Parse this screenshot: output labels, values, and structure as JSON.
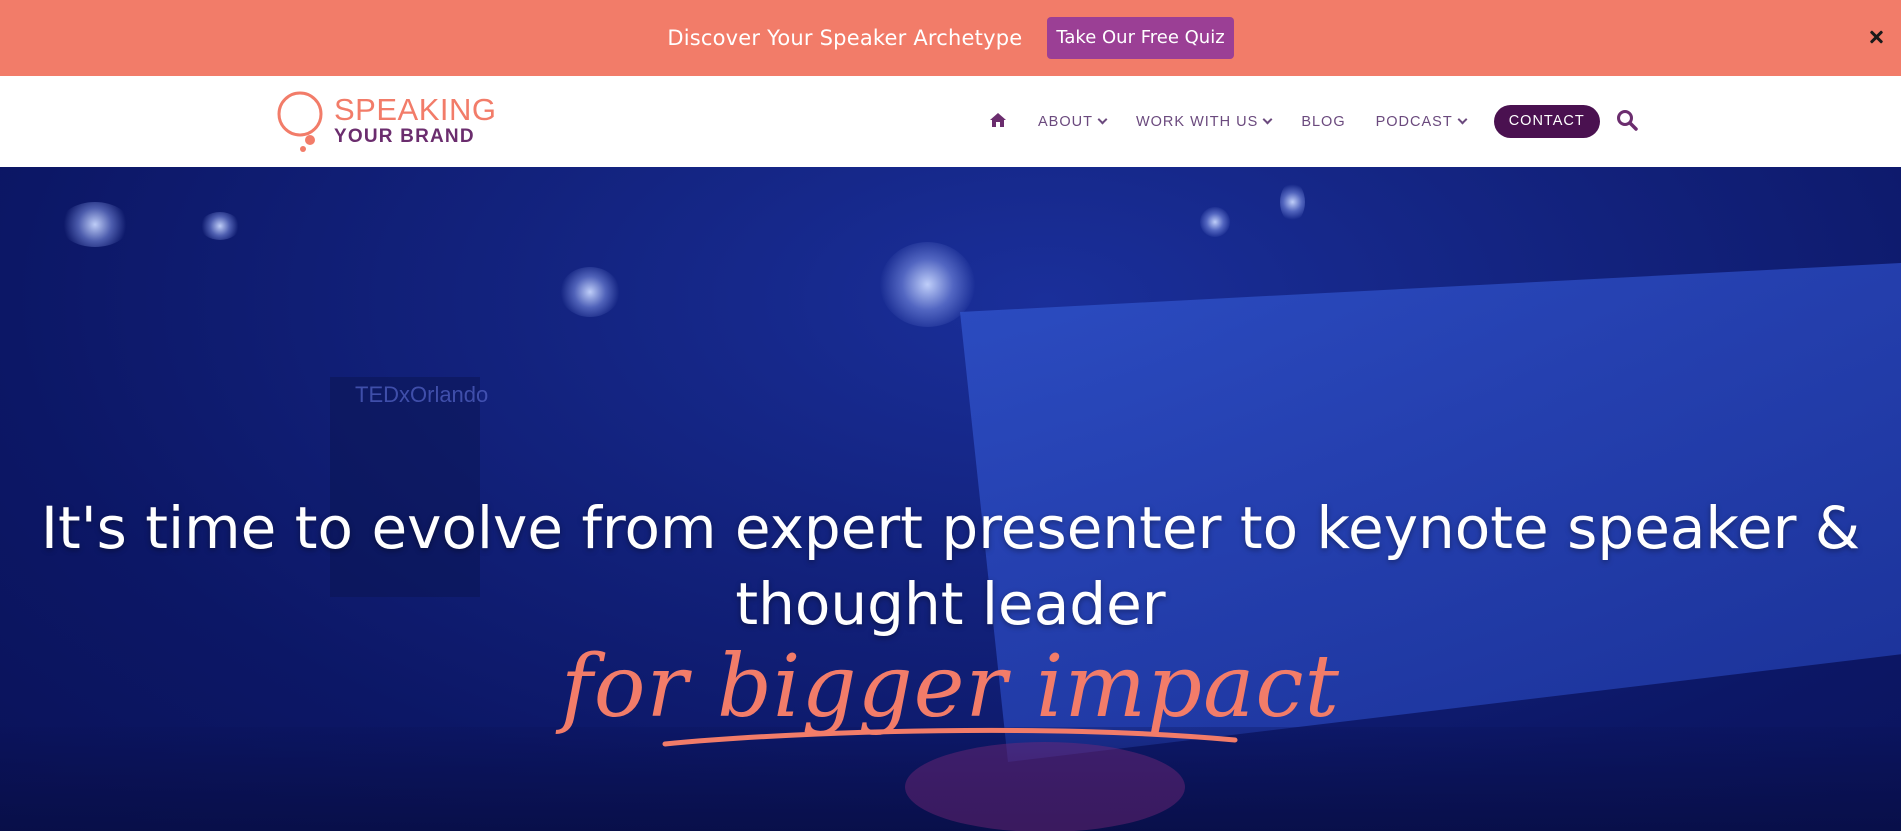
{
  "announcement": {
    "text": "Discover Your Speaker Archetype",
    "cta_label": "Take Our Free Quiz"
  },
  "logo": {
    "line1": "SPEAKING",
    "line2": "YOUR BRAND"
  },
  "nav": {
    "items": [
      {
        "label": "ABOUT",
        "dropdown": true
      },
      {
        "label": "WORK WITH US",
        "dropdown": true
      },
      {
        "label": "BLOG",
        "dropdown": false
      },
      {
        "label": "PODCAST",
        "dropdown": true
      }
    ],
    "contact_label": "CONTACT"
  },
  "hero": {
    "headline_line1": "It's time to evolve from expert presenter to keynote speaker &",
    "headline_line2": "thought leader",
    "script_text": "for bigger impact",
    "sign_text": "TEDxOrlando"
  },
  "colors": {
    "announcement_bg": "#f27c69",
    "quiz_button": "#9b3f95",
    "contact_button": "#4a1150",
    "accent_coral": "#f27c69",
    "nav_text": "#6b4a7e",
    "hero_overlay": "#0d1b6b"
  },
  "icons": [
    "close-icon",
    "home-icon",
    "chevron-down-icon",
    "search-icon",
    "logo-speech-bubble-icon"
  ]
}
